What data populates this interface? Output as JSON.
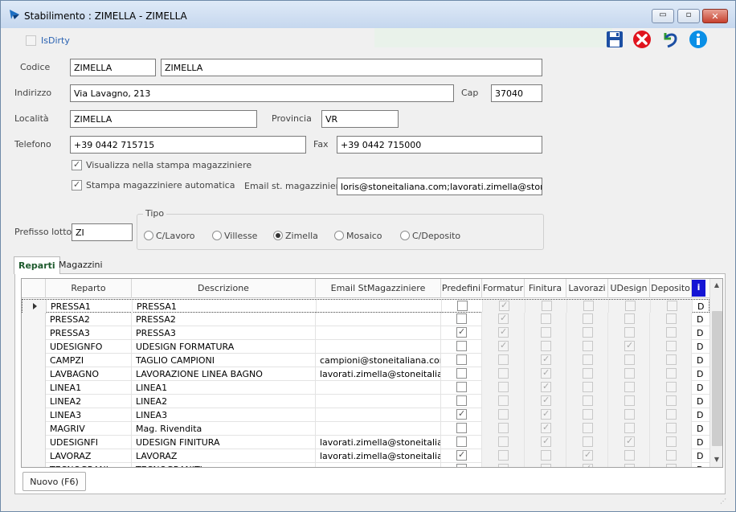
{
  "window": {
    "title": "Stabilimento : ZIMELLA - ZIMELLA",
    "minimize": "▭",
    "maximize": "▫",
    "close": "✕"
  },
  "toolbar": {
    "isdirty_label": "IsDirty",
    "icons": [
      "save-icon",
      "cancel-icon",
      "undo-icon",
      "info-icon"
    ]
  },
  "form": {
    "codice_label": "Codice",
    "codice": "ZIMELLA",
    "codice_desc": "ZIMELLA",
    "indirizzo_label": "Indirizzo",
    "indirizzo": "Via Lavagno, 213",
    "cap_label": "Cap",
    "cap": "37040",
    "localita_label": "Località",
    "localita": "ZIMELLA",
    "provincia_label": "Provincia",
    "provincia": "VR",
    "telefono_label": "Telefono",
    "telefono": "+39 0442 715715",
    "fax_label": "Fax",
    "fax": "+39 0442 715000",
    "visualizza_label": "Visualizza nella stampa magazziniere",
    "visualizza_checked": true,
    "stampa_label": "Stampa magazziniere automatica",
    "stampa_checked": true,
    "email_label": "Email st. magazziniere",
    "email": "loris@stoneitaliana.com;lavorati.zimella@stoneita",
    "prefisso_label": "Prefisso lotto",
    "prefisso": "ZI"
  },
  "tipo": {
    "label": "Tipo",
    "options": [
      "C/Lavoro",
      "Villesse",
      "Zimella",
      "Mosaico",
      "C/Deposito"
    ],
    "selected": "Zimella"
  },
  "tabs": [
    "Reparti",
    "Magazzini"
  ],
  "grid": {
    "columns": [
      "Reparto",
      "Descrizione",
      "Email StMagazziniere",
      "Predefini",
      "Formatur",
      "Finitura",
      "Lavorazi",
      "UDesign",
      "Deposito",
      "i"
    ],
    "rows": [
      {
        "reparto": "PRESSA1",
        "descrizione": "PRESSA1",
        "email": "",
        "predef": false,
        "form": true,
        "fin": false,
        "lav": false,
        "udes": false,
        "dep": false,
        "d": "D"
      },
      {
        "reparto": "PRESSA2",
        "descrizione": "PRESSA2",
        "email": "",
        "predef": false,
        "form": true,
        "fin": false,
        "lav": false,
        "udes": false,
        "dep": false,
        "d": "D"
      },
      {
        "reparto": "PRESSA3",
        "descrizione": "PRESSA3",
        "email": "",
        "predef": true,
        "form": true,
        "fin": false,
        "lav": false,
        "udes": false,
        "dep": false,
        "d": "D"
      },
      {
        "reparto": "UDESIGNFO",
        "descrizione": "UDESIGN FORMATURA",
        "email": "",
        "predef": false,
        "form": true,
        "fin": false,
        "lav": false,
        "udes": true,
        "dep": false,
        "d": "D"
      },
      {
        "reparto": "CAMPZI",
        "descrizione": "TAGLIO CAMPIONI",
        "email": "campioni@stoneitaliana.com",
        "predef": false,
        "form": false,
        "fin": true,
        "lav": false,
        "udes": false,
        "dep": false,
        "d": "D"
      },
      {
        "reparto": "LAVBAGNO",
        "descrizione": "LAVORAZIONE LINEA BAGNO",
        "email": "lavorati.zimella@stoneitalian",
        "predef": false,
        "form": false,
        "fin": true,
        "lav": false,
        "udes": false,
        "dep": false,
        "d": "D"
      },
      {
        "reparto": "LINEA1",
        "descrizione": "LINEA1",
        "email": "",
        "predef": false,
        "form": false,
        "fin": true,
        "lav": false,
        "udes": false,
        "dep": false,
        "d": "D"
      },
      {
        "reparto": "LINEA2",
        "descrizione": "LINEA2",
        "email": "",
        "predef": false,
        "form": false,
        "fin": true,
        "lav": false,
        "udes": false,
        "dep": false,
        "d": "D"
      },
      {
        "reparto": "LINEA3",
        "descrizione": "LINEA3",
        "email": "",
        "predef": true,
        "form": false,
        "fin": true,
        "lav": false,
        "udes": false,
        "dep": false,
        "d": "D"
      },
      {
        "reparto": "MAGRIV",
        "descrizione": "Mag. Rivendita",
        "email": "",
        "predef": false,
        "form": false,
        "fin": true,
        "lav": false,
        "udes": false,
        "dep": false,
        "d": "D"
      },
      {
        "reparto": "UDESIGNFI",
        "descrizione": "UDESIGN FINITURA",
        "email": "lavorati.zimella@stoneitalian",
        "predef": false,
        "form": false,
        "fin": true,
        "lav": false,
        "udes": true,
        "dep": false,
        "d": "D"
      },
      {
        "reparto": "LAVORAZ",
        "descrizione": "LAVORAZ",
        "email": "lavorati.zimella@stoneitalian",
        "predef": true,
        "form": false,
        "fin": false,
        "lav": true,
        "udes": false,
        "dep": false,
        "d": "D"
      },
      {
        "reparto": "TECNOGRANI",
        "descrizione": "TECNOGRANITI",
        "email": "",
        "predef": false,
        "form": false,
        "fin": false,
        "lav": true,
        "udes": false,
        "dep": false,
        "d": "D"
      }
    ]
  },
  "buttons": {
    "nuovo": "Nuovo (F6)"
  }
}
